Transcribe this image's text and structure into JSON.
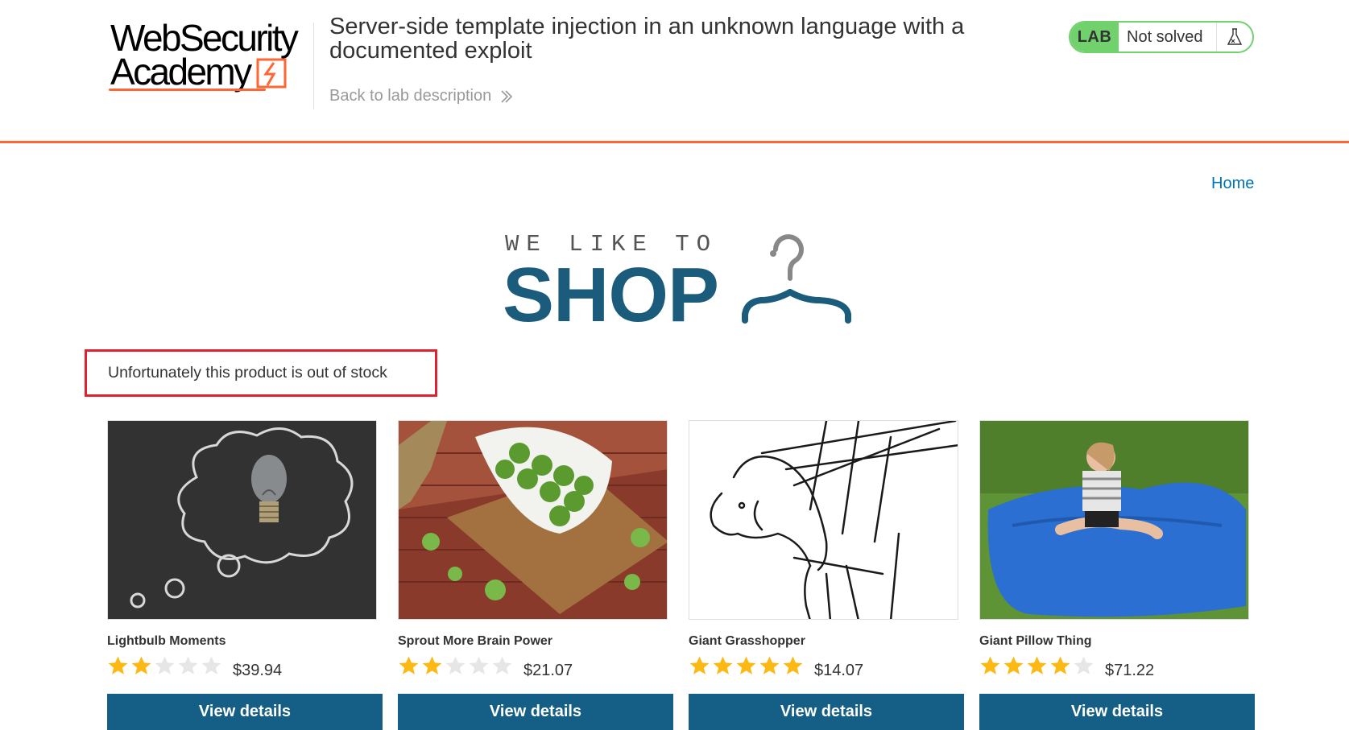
{
  "header": {
    "logo_line1": "WebSecurity",
    "logo_line2": "Academy",
    "lab_title": "Server-side template injection in an unknown language with a documented exploit",
    "back_link": "Back to lab description",
    "lab_tag": "LAB",
    "lab_status": "Not solved"
  },
  "nav": {
    "home": "Home"
  },
  "banner": {
    "tagline": "WE LIKE TO",
    "word": "SHOP"
  },
  "message": "Unfortunately this product is out of stock",
  "products": [
    {
      "name": "Lightbulb Moments",
      "price": "$39.94",
      "rating": 2,
      "image": "lightbulb-chalkboard",
      "button": "View details"
    },
    {
      "name": "Sprout More Brain Power",
      "price": "$21.07",
      "rating": 2,
      "image": "brussels-sprouts-bowl",
      "button": "View details"
    },
    {
      "name": "Giant Grasshopper",
      "price": "$14.07",
      "rating": 5,
      "image": "grasshopper-sketch",
      "button": "View details"
    },
    {
      "name": "Giant Pillow Thing",
      "price": "$71.22",
      "rating": 4,
      "image": "girl-on-blue-pillow",
      "button": "View details"
    }
  ],
  "colors": {
    "accent_orange": "#ff6633",
    "lab_green": "#70d16d",
    "button_blue": "#155e85",
    "link_blue": "#0071bc",
    "message_border": "#e3202f",
    "star_gold": "#fdb913"
  },
  "icons": {
    "flask": "flask-icon",
    "chevrons": "double-chevron-right-icon",
    "hanger": "hanger-icon",
    "star": "star-icon"
  }
}
